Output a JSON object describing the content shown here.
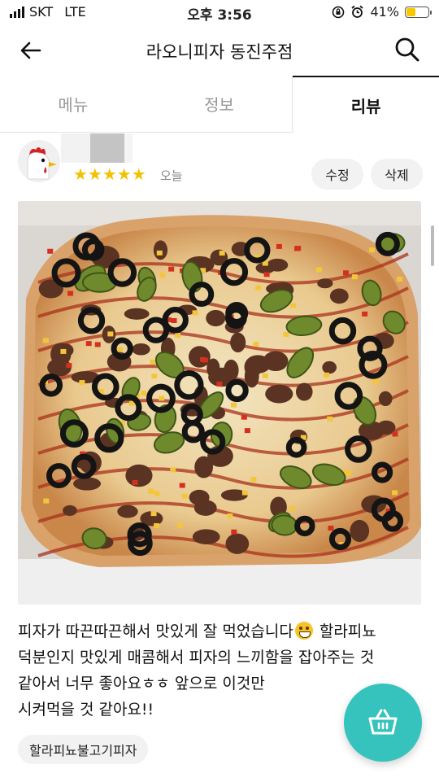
{
  "status_bar": {
    "carrier": "SKT",
    "network": "LTE",
    "time": "오후 3:56",
    "battery": "41%",
    "battery_level": 0.41
  },
  "header": {
    "title": "라오니피자 동진주점",
    "back_icon": "back-arrow-icon",
    "search_icon": "search-icon"
  },
  "tabs": [
    {
      "label": "메뉴",
      "active": false
    },
    {
      "label": "정보",
      "active": false
    },
    {
      "label": "리뷰",
      "active": true
    }
  ],
  "review": {
    "rating": 5,
    "stars": "★★★★★",
    "date": "오늘",
    "edit_label": "수정",
    "delete_label": "삭제",
    "text_lines": [
      "피자가 따끈따끈해서 맛있게 잘 먹었습니다",
      " 할라피뇨",
      "덕분인지 맛있게 매콤해서 피자의 느끼함을 잡아주는 것",
      "같아서 너무 좋아요ㅎㅎ 앞으로 이것만",
      "시켜먹을 것 같아요!!"
    ],
    "menu_tag": "할라피뇨불고기피자"
  },
  "colors": {
    "accent": "#36c3bd",
    "star": "#f2c200"
  },
  "fab_icon": "shopping-basket-icon"
}
